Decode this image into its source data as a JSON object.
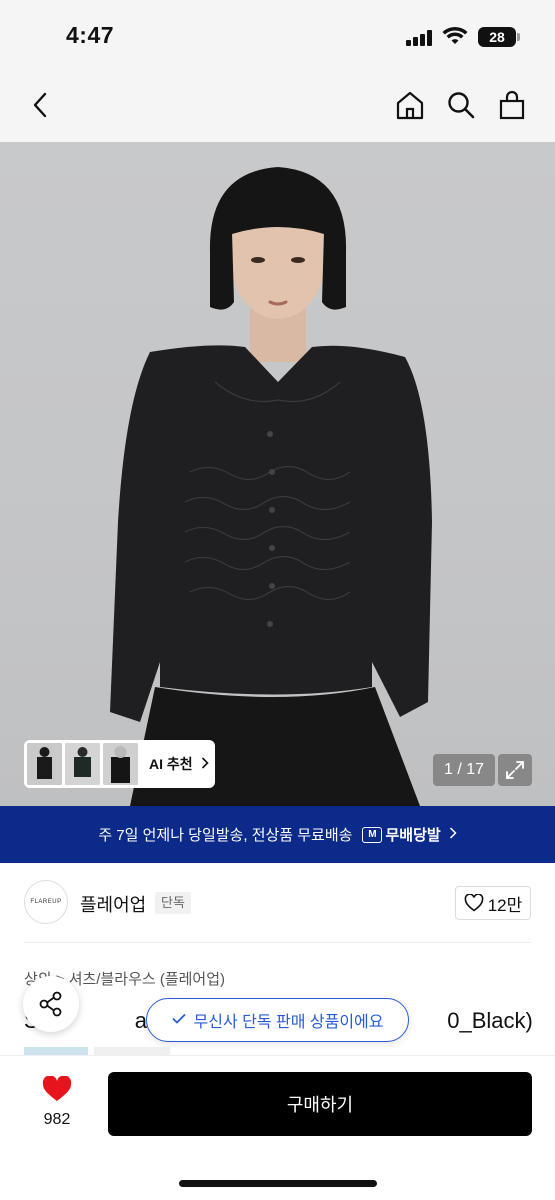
{
  "status_bar": {
    "time": "4:47",
    "battery": "28"
  },
  "nav": {
    "icons": [
      "back-icon",
      "home-icon",
      "search-icon",
      "cart-icon"
    ]
  },
  "hero": {
    "ai_recommend_label": "AI 추천",
    "page_counter": "1 / 17"
  },
  "banner": {
    "text": "주 7일 언제나 당일발송, 전상품 무료배송",
    "badge_letter": "M",
    "badge_label": "무배당발"
  },
  "brand": {
    "logo_text": "FLAREUP",
    "name": "플레어업",
    "tag": "단독",
    "likes": "12만"
  },
  "product": {
    "breadcrumb": "상의 > 셔츠/블라우스 (플레어업)",
    "title_left": "S",
    "title_mid": "a Frill P",
    "title_right": "0_Black)"
  },
  "overlay": {
    "exclusive_notice": "무신사 단독 판매 상품이에요"
  },
  "bottom": {
    "heart_count": "982",
    "buy_label": "구매하기"
  },
  "colors": {
    "banner_bg": "#0b2a8a",
    "accent_blue": "#2a5bd7",
    "heart_red": "#e8141c"
  }
}
